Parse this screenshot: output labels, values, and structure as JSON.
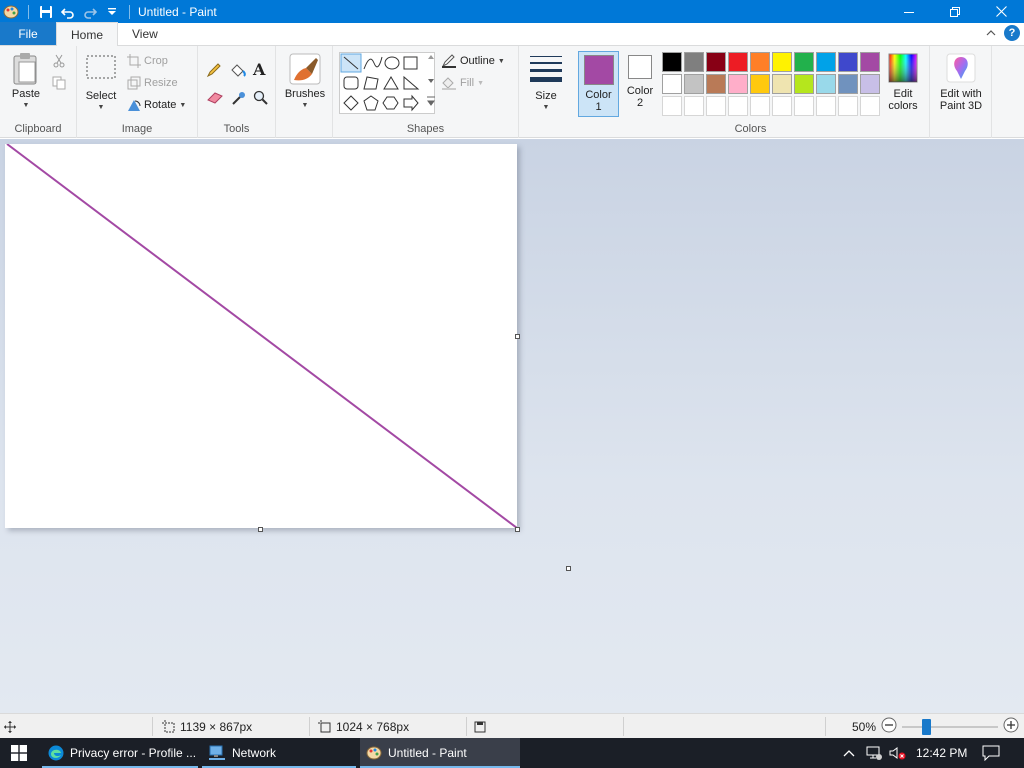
{
  "window": {
    "title": "Untitled - Paint"
  },
  "ribbon_tabs": {
    "file": "File",
    "home": "Home",
    "view": "View"
  },
  "clipboard": {
    "paste": "Paste",
    "cut": "",
    "copy": "",
    "label": "Clipboard"
  },
  "image": {
    "select": "Select",
    "crop": "Crop",
    "resize": "Resize",
    "rotate": "Rotate",
    "label": "Image"
  },
  "tools": {
    "label": "Tools"
  },
  "brushes": {
    "label": "Brushes"
  },
  "shapes": {
    "outline": "Outline",
    "fill": "Fill",
    "label": "Shapes"
  },
  "size": {
    "label": "Size"
  },
  "colors": {
    "color1_line1": "Color",
    "color1_line2": "1",
    "color2_line1": "Color",
    "color2_line2": "2",
    "edit_line1": "Edit",
    "edit_line2": "colors",
    "label": "Colors",
    "color1": "#a349a4",
    "color2": "#ffffff",
    "row1": [
      "#000000",
      "#7f7f7f",
      "#880015",
      "#ed1c24",
      "#ff7f27",
      "#fff200",
      "#22b14c",
      "#00a2e8",
      "#3f48cc",
      "#a349a4"
    ],
    "row2": [
      "#ffffff",
      "#c3c3c3",
      "#b97a57",
      "#ffaec9",
      "#ffc90e",
      "#efe4b0",
      "#b5e61d",
      "#99d9ea",
      "#7092be",
      "#c8bfe7"
    ],
    "row3": [
      "#ffffff",
      "#ffffff",
      "#ffffff",
      "#ffffff",
      "#ffffff",
      "#ffffff",
      "#ffffff",
      "#ffffff",
      "#ffffff",
      "#ffffff"
    ]
  },
  "paint3d": {
    "line1": "Edit with",
    "line2": "Paint 3D"
  },
  "canvas": {
    "stroke_color": "#a349a4"
  },
  "status": {
    "selection_size": "1139 × 867px",
    "image_size": "1024 × 768px",
    "zoom": "50%"
  },
  "taskbar": {
    "apps": [
      {
        "label": "Privacy error - Profile ..."
      },
      {
        "label": "Network"
      },
      {
        "label": "Untitled - Paint"
      }
    ],
    "clock": "12:42 PM"
  }
}
